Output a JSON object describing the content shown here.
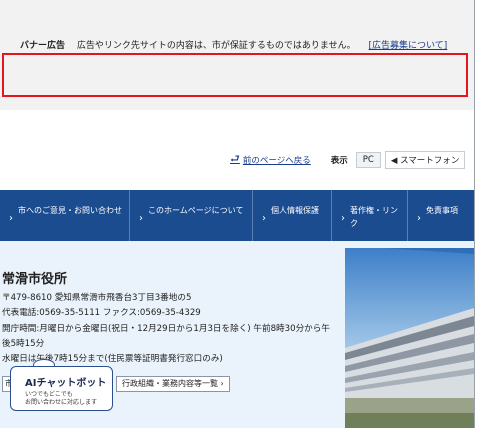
{
  "banner": {
    "title": "バナー広告",
    "notice": "広告やリンク先サイトの内容は、市が保証するものではありません。",
    "link": "[広告募集について]"
  },
  "util": {
    "back": "前のページへ戻る",
    "display_label": "表示",
    "pc": "PC",
    "smartphone": "◀ スマートフォン"
  },
  "nav": {
    "items": [
      {
        "label": "市へのご意見・お問い合わせ"
      },
      {
        "label": "このホームページについて"
      },
      {
        "label": "個人情報保護"
      },
      {
        "label": "著作権・リンク"
      },
      {
        "label": "免責事項"
      }
    ]
  },
  "footer": {
    "name": "常滑市役所",
    "address": "〒479-8610 愛知県常滑市飛香台3丁目3番地の5",
    "phone": "代表電話:0569-35-5111 ファクス:0569-35-4329",
    "hours": "開庁時間:月曜日から金曜日(祝日・12月29日から1月3日を除く) 午前8時30分から午",
    "hours2": "後5時15分",
    "wednesday": "水曜日は午後7時15分まで(住民票等証明書発行窓口のみ)",
    "btn_org": "行政組織・業務内容等一覧 ›",
    "btn_access_fragment": "市"
  },
  "chatbot": {
    "title": "AIチャットボット",
    "sub1": "いつでもどこでも",
    "sub2": "お問い合わせに対応します"
  }
}
